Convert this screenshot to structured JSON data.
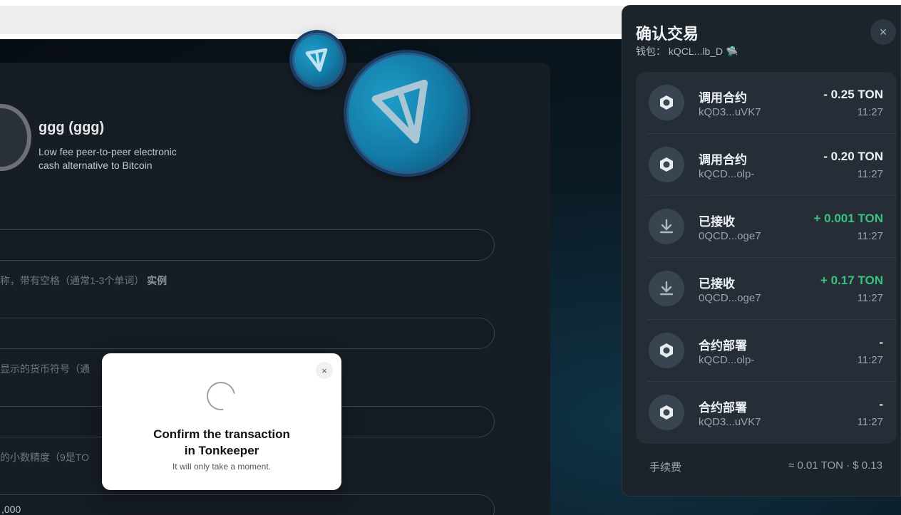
{
  "token": {
    "name": "ggg (ggg)",
    "description_line1": "Low fee peer-to-peer electronic",
    "description_line2": "cash alternative to Bitcoin"
  },
  "form": {
    "name_hint": "称，带有空格（通常1-3个单词）",
    "name_hint_link": "实例",
    "symbol_hint": "显示的货币符号（通",
    "decimals_hint": "的小数精度（9是TO",
    "supply_value": ",000"
  },
  "popup": {
    "title_line1": "Confirm the transaction",
    "title_line2": "in Tonkeeper",
    "subtitle": "It will only take a moment.",
    "close": "×"
  },
  "panel": {
    "title": "确认交易",
    "wallet_label": "钱包：",
    "wallet_address": "kQCL...lb_D",
    "wallet_emoji": "🛸",
    "close": "×",
    "transactions": [
      {
        "label": "调用合约",
        "address": "kQD3...uVK7",
        "amount": "- 0.25 TON",
        "time": "11:27",
        "icon": "contract-icon",
        "positive": false
      },
      {
        "label": "调用合约",
        "address": "kQCD...olp-",
        "amount": "- 0.20 TON",
        "time": "11:27",
        "icon": "contract-icon",
        "positive": false
      },
      {
        "label": "已接收",
        "address": "0QCD...oge7",
        "amount": "+ 0.001 TON",
        "time": "11:27",
        "icon": "receive-icon",
        "positive": true
      },
      {
        "label": "已接收",
        "address": "0QCD...oge7",
        "amount": "+ 0.17 TON",
        "time": "11:27",
        "icon": "receive-icon",
        "positive": true
      },
      {
        "label": "合约部署",
        "address": "kQCD...olp-",
        "amount": "-",
        "time": "11:27",
        "icon": "contract-icon",
        "positive": false
      },
      {
        "label": "合约部署",
        "address": "kQD3...uVK7",
        "amount": "-",
        "time": "11:27",
        "icon": "contract-icon",
        "positive": false
      }
    ],
    "fee_label": "手续费",
    "fee_value": "≈ 0.01 TON · $ 0.13"
  },
  "colors": {
    "accent_positive": "#39c27e",
    "ton_blue": "#1f9cc8",
    "panel_bg": "#1b232b"
  }
}
